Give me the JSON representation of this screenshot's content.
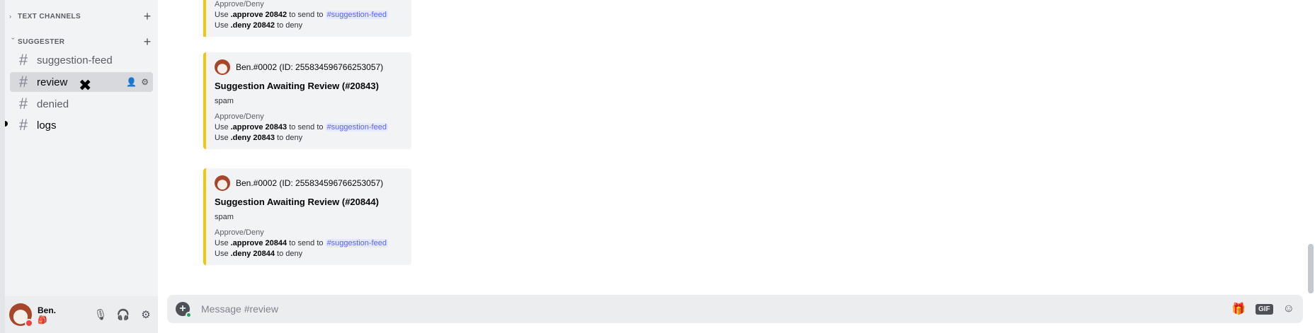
{
  "sidebar": {
    "categories": [
      {
        "label": "TEXT CHANNELS",
        "chevron": "›",
        "add": "+"
      },
      {
        "label": "SUGGESTER",
        "chevron": "›",
        "add": "+"
      }
    ],
    "channels": [
      {
        "label": "suggestion-feed"
      },
      {
        "label": "review"
      },
      {
        "label": "denied"
      },
      {
        "label": "logs"
      }
    ],
    "hash": "#"
  },
  "user": {
    "name": "Ben.",
    "status_emoji": "🎒"
  },
  "embeds": [
    {
      "field_name": "Approve/Deny",
      "approve_prefix": "Use ",
      "approve_cmd": ".approve 20842",
      "approve_mid": " to send to ",
      "approve_channel": "#suggestion-feed",
      "deny_prefix": "Use ",
      "deny_cmd": ".deny 20842",
      "deny_suffix": " to deny"
    },
    {
      "author": "Ben.#0002 (ID: 255834596766253057)",
      "title": "Suggestion Awaiting Review (#20843)",
      "description": "spam",
      "field_name": "Approve/Deny",
      "approve_prefix": "Use ",
      "approve_cmd": ".approve 20843",
      "approve_mid": " to send to ",
      "approve_channel": "#suggestion-feed",
      "deny_prefix": "Use ",
      "deny_cmd": ".deny 20843",
      "deny_suffix": " to deny"
    },
    {
      "author": "Ben.#0002 (ID: 255834596766253057)",
      "title": "Suggestion Awaiting Review (#20844)",
      "description": "spam",
      "field_name": "Approve/Deny",
      "approve_prefix": "Use ",
      "approve_cmd": ".approve 20844",
      "approve_mid": " to send to ",
      "approve_channel": "#suggestion-feed",
      "deny_prefix": "Use ",
      "deny_cmd": ".deny 20844",
      "deny_suffix": " to deny"
    }
  ],
  "composer": {
    "placeholder": "Message #review",
    "gif": "GIF"
  },
  "colors": {
    "embed_accent": "#f0c60f",
    "mention": "#5865f2",
    "dnd": "#f23f43"
  }
}
